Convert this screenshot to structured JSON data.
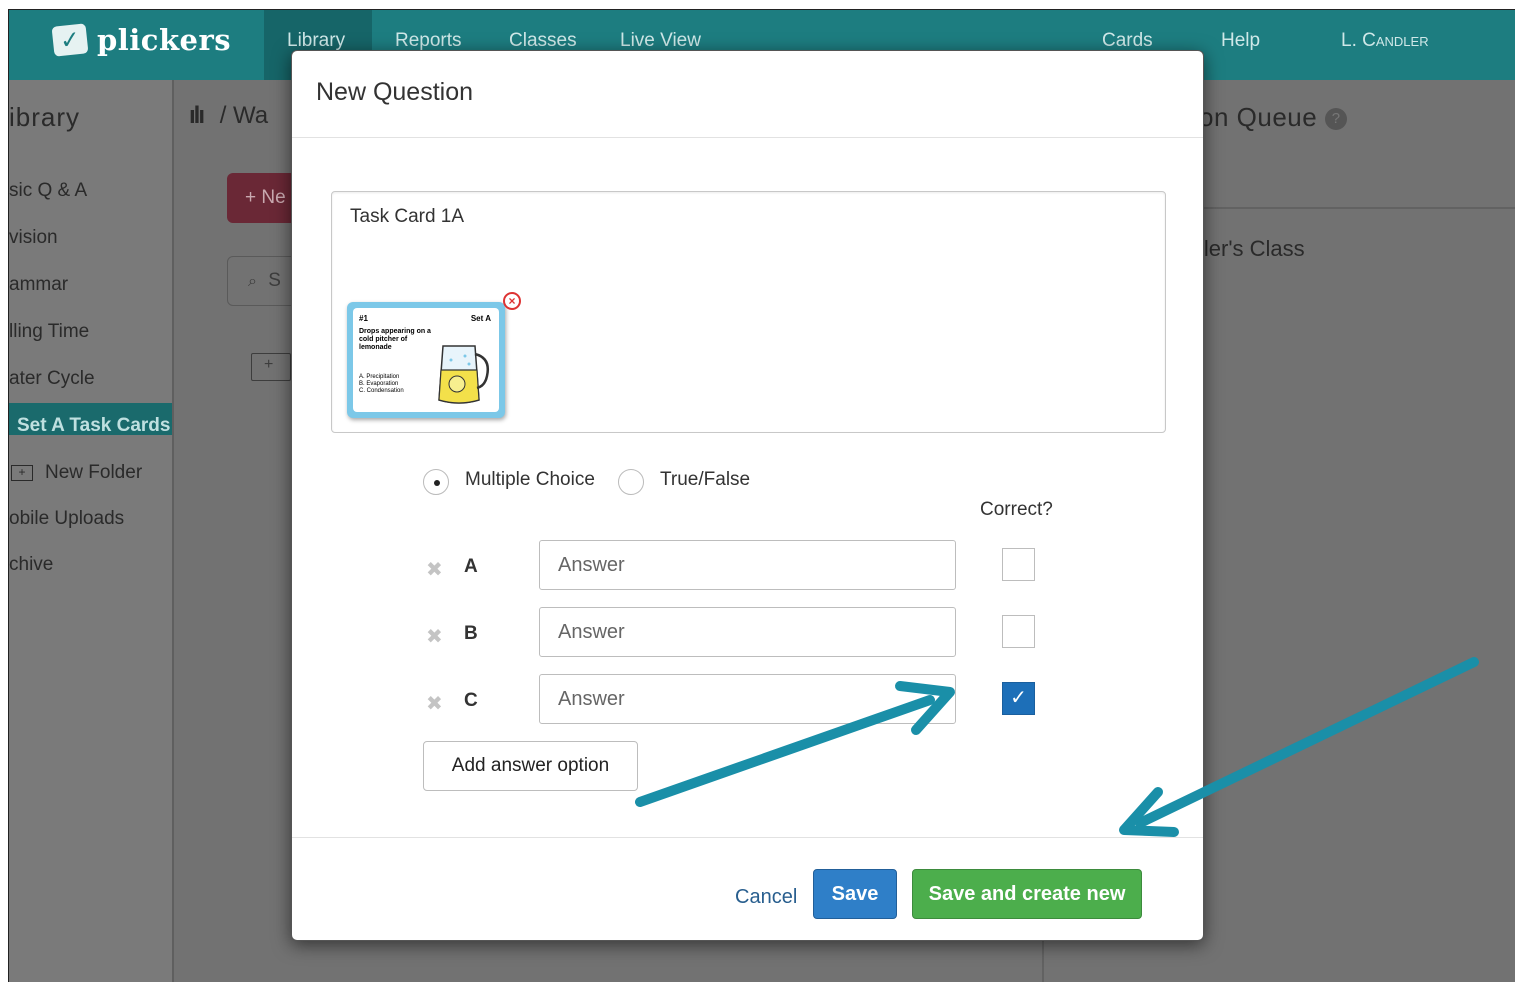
{
  "app": {
    "logo_text": "plickers"
  },
  "nav": {
    "items": [
      "Library",
      "Reports",
      "Classes",
      "Live View"
    ],
    "right_items": [
      "Cards",
      "Help",
      "L. Candler"
    ]
  },
  "sidebar": {
    "title": "ibrary",
    "items": [
      "sic Q & A",
      "vision",
      "ammar",
      "lling Time",
      "ater Cycle",
      "Set A Task Cards",
      "New Folder",
      "obile Uploads",
      "chive"
    ],
    "active_index": 5
  },
  "main": {
    "breadcrumb": "/ Wa",
    "new_button": "+ Ne",
    "search_fragment": "S"
  },
  "queue": {
    "title": "on Queue",
    "help_glyph": "?",
    "class_name": "ller's Class"
  },
  "modal": {
    "title": "New Question",
    "question_text": "Task Card 1A",
    "task_card": {
      "number": "#1",
      "set": "Set A",
      "question": "Drops appearing on a cold pitcher of lemonade",
      "options": [
        "A. Precipitation",
        "B. Evaporation",
        "C. Condensation"
      ]
    },
    "question_types": [
      {
        "label": "Multiple Choice",
        "selected": true
      },
      {
        "label": "True/False",
        "selected": false
      }
    ],
    "correct_header": "Correct?",
    "answers": [
      {
        "letter": "A",
        "value": "",
        "placeholder": "Answer",
        "correct": false
      },
      {
        "letter": "B",
        "value": "",
        "placeholder": "Answer",
        "correct": false
      },
      {
        "letter": "C",
        "value": "",
        "placeholder": "Answer",
        "correct": true
      }
    ],
    "add_option_label": "Add answer option",
    "cancel_label": "Cancel",
    "save_label": "Save",
    "save_new_label": "Save and create new"
  },
  "colors": {
    "topbar": "#1d7d80",
    "save": "#2f7fc8",
    "save_new": "#4cae4c",
    "checkbox_on": "#1d6fb8",
    "annotation_arrow": "#1a8fa8"
  },
  "icons": {
    "logo": "check-card-icon",
    "library": "books-icon",
    "remove_answer": "x-icon",
    "remove_image": "close-circle-icon",
    "help": "question-circle-icon"
  }
}
